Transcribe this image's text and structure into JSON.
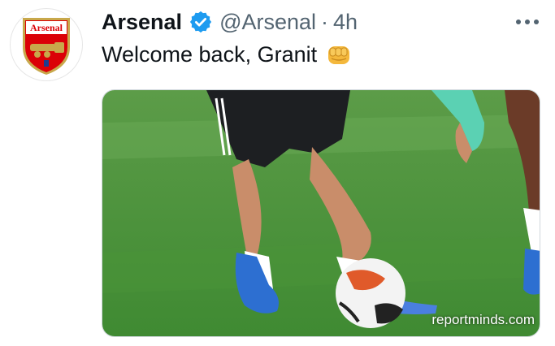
{
  "tweet": {
    "author_name": "Arsenal",
    "handle": "@Arsenal",
    "separator": "·",
    "time": "4h",
    "text": "Welcome back, Granit",
    "emoji": "fist-emoji",
    "verified": true
  },
  "avatar": {
    "logo_text": "Arsenal",
    "icon": "arsenal-crest-icon"
  },
  "media": {
    "watermark": "reportminds.com"
  },
  "colors": {
    "verified": "#1d9bf0",
    "muted": "#536471",
    "pitch": "#4f9a3e",
    "crest_red": "#db0007"
  }
}
